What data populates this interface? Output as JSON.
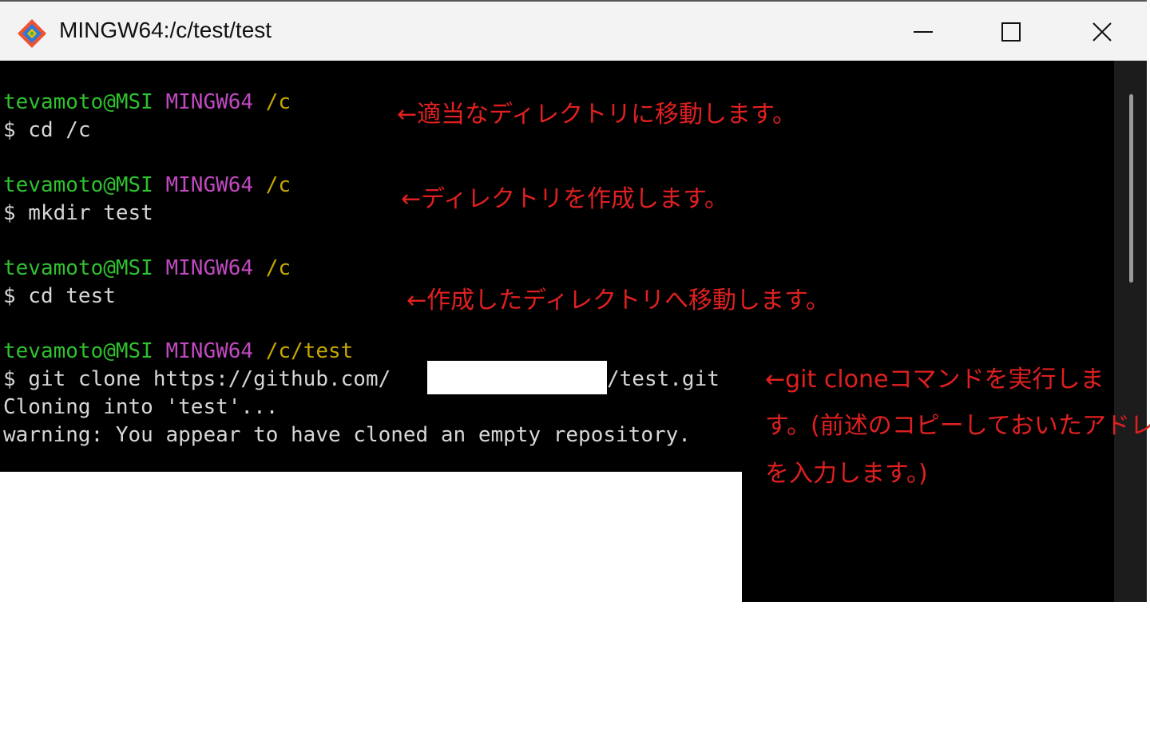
{
  "window": {
    "title": "MINGW64:/c/test/test",
    "controls": [
      "minimize-icon",
      "maximize-icon",
      "close-icon"
    ]
  },
  "terminal": {
    "blocks": [
      {
        "user": "tevamoto@MSI",
        "shell": "MINGW64",
        "path": "/c",
        "command": "$ cd /c"
      },
      {
        "user": "tevamoto@MSI",
        "shell": "MINGW64",
        "path": "/c",
        "command": "$ mkdir test"
      },
      {
        "user": "tevamoto@MSI",
        "shell": "MINGW64",
        "path": "/c",
        "command": "$ cd test"
      },
      {
        "user": "tevamoto@MSI",
        "shell": "MINGW64",
        "path": "/c/test",
        "command_prefix": "$ git clone https://github.com/",
        "command_suffix": "/test.git"
      }
    ],
    "output": [
      "Cloning into 'test'...",
      "warning: You appear to have cloned an empty repository."
    ]
  },
  "annotations": [
    "←適当なディレクトリに移動します。",
    "←ディレクトリを作成します。",
    "←作成したディレクトリへ移動します。",
    "←git cloneコマンドを実行しま",
    "す。(前述のコピーしておいたアドレス",
    "を入力します。)"
  ],
  "colors": {
    "prompt_user": "#2fc12f",
    "prompt_shell": "#c049c0",
    "prompt_path": "#c6a700",
    "annotation": "#e02020"
  }
}
